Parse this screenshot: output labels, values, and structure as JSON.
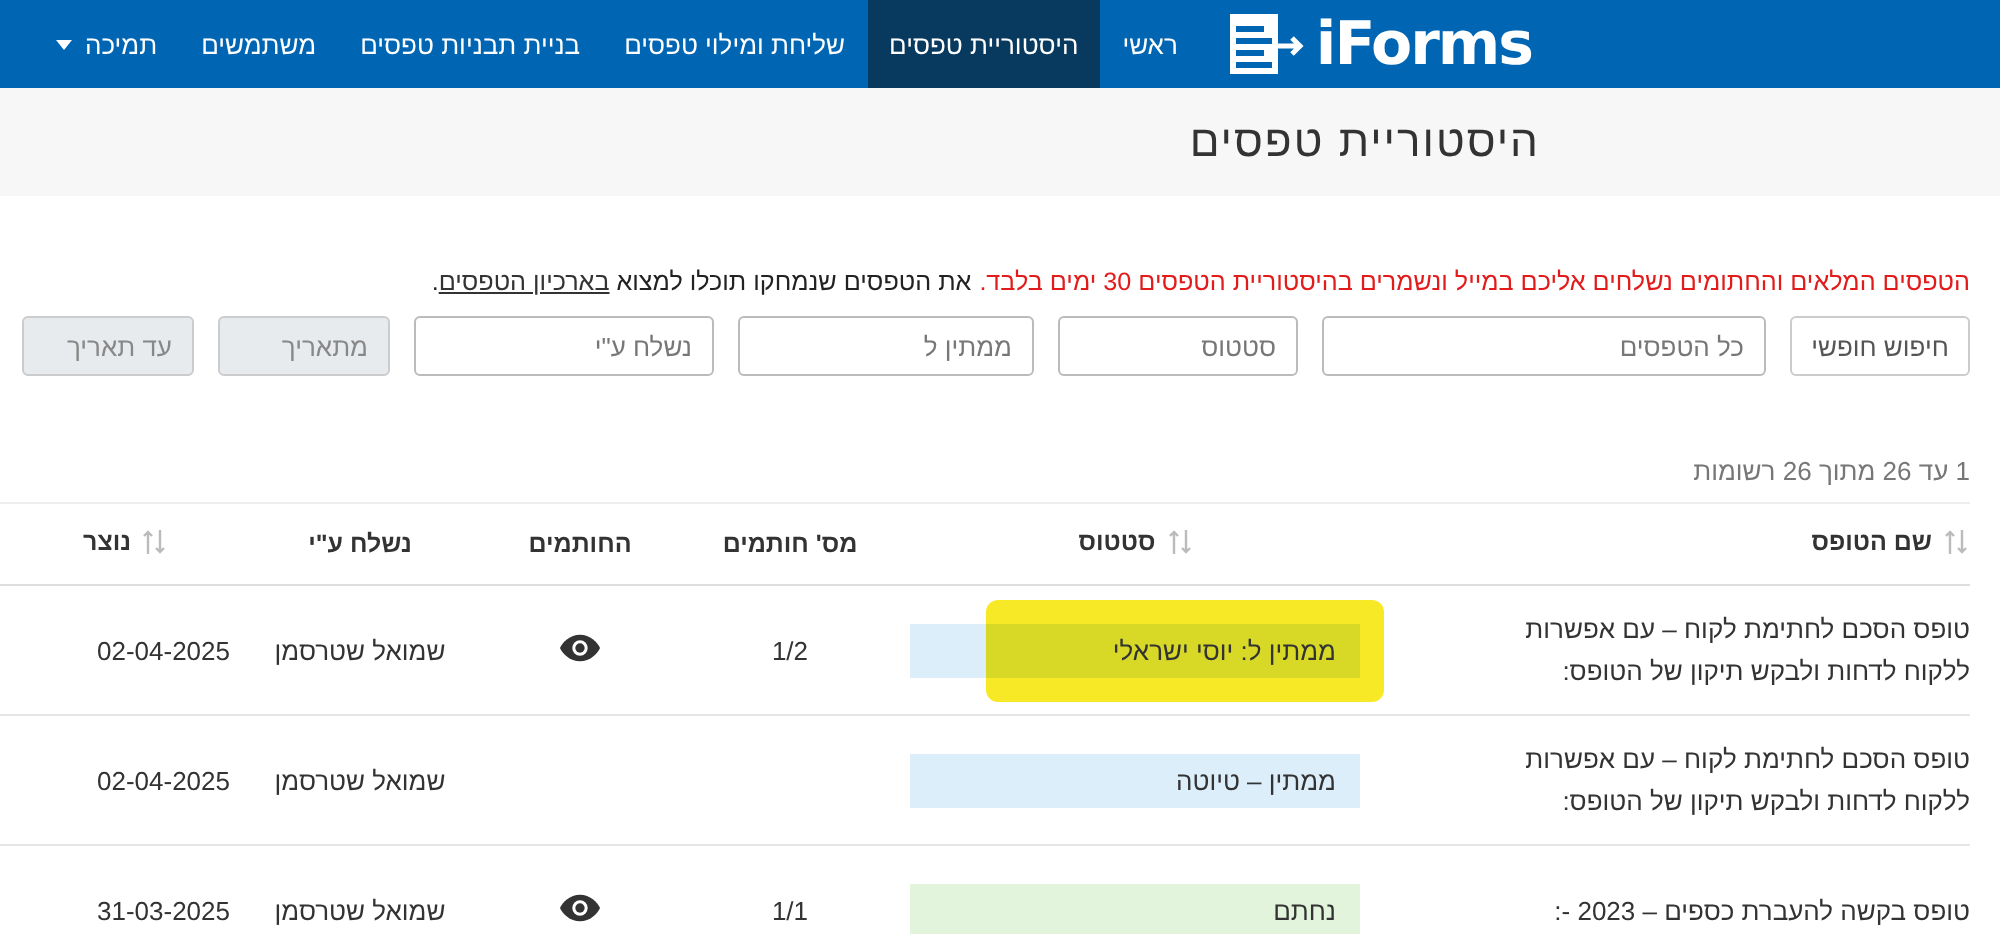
{
  "navbar": {
    "logo": "iForms",
    "items": [
      {
        "label": "ראשי",
        "selected": false,
        "dropdown": false
      },
      {
        "label": "היסטוריית טפסים",
        "selected": true,
        "dropdown": false
      },
      {
        "label": "שליחת ומילוי טפסים",
        "selected": false,
        "dropdown": false
      },
      {
        "label": "בניית תבניות טפסים",
        "selected": false,
        "dropdown": false
      },
      {
        "label": "משתמשים",
        "selected": false,
        "dropdown": false
      },
      {
        "label": "תמיכה",
        "selected": false,
        "dropdown": true
      }
    ]
  },
  "page_title": "היסטוריית טפסים",
  "notice": {
    "warning": "הטפסים המלאים והחתומים נשלחים אליכם במייל ונשמרים בהיסטוריית הטפסים 30 ימים בלבד.",
    "text": "את הטפסים שנמחקו תוכלו למצוא",
    "link": "בארכיון הטפסים",
    "end": "."
  },
  "filters": [
    {
      "kind": "button",
      "label": "חיפוש חופשי"
    },
    {
      "kind": "field",
      "placeholder": "כל הטפסים",
      "disabled": false
    },
    {
      "kind": "field",
      "placeholder": "סטטוס",
      "disabled": false
    },
    {
      "kind": "field",
      "placeholder": "ממתין ל",
      "disabled": false
    },
    {
      "kind": "field",
      "placeholder": "נשלח ע\"י",
      "disabled": false
    },
    {
      "kind": "field",
      "placeholder": "מתאריך",
      "disabled": true
    },
    {
      "kind": "field",
      "placeholder": "עד תאריך",
      "disabled": true
    }
  ],
  "record_count": "1 עד 26 מתוך 26 רשומות",
  "table": {
    "columns": [
      {
        "label": "שם הטופס",
        "sortable": true
      },
      {
        "label": "סטטוס",
        "sortable": true
      },
      {
        "label": "מס' חותמים",
        "sortable": false
      },
      {
        "label": "החותמים",
        "sortable": false
      },
      {
        "label": "נשלח ע\"י",
        "sortable": false
      },
      {
        "label": "נוצר",
        "sortable": true
      }
    ],
    "rows": [
      {
        "name": "טופס הסכם לחתימת לקוח – עם אפשרות ללקוח לדחות ולבקש תיקון של הטופס:",
        "status": {
          "label": "ממתין ל: יוסי ישראלי",
          "color": "#ddeefb"
        },
        "highlighted": true,
        "signers_count": "1/2",
        "has_signers_view": true,
        "sent_by": "שמואל שטרסמן",
        "created": "02-04-2025"
      },
      {
        "name": "טופס הסכם לחתימת לקוח – עם אפשרות ללקוח לדחות ולבקש תיקון של הטופס:",
        "status": {
          "label": "ממתין – טיוטה",
          "color": "#ddeefb"
        },
        "highlighted": false,
        "has_signers_view": false,
        "sent_by": "שמואל שטרסמן",
        "created": "02-04-2025"
      },
      {
        "name": "טופס בקשה להעברת כספים – 2023 -:",
        "status": {
          "label": "נחתם",
          "color": "#e2f5dc"
        },
        "highlighted": false,
        "signers_count": "1/1",
        "has_signers_view": true,
        "sent_by": "שמואל שטרסמן",
        "created": "31-03-2025"
      }
    ]
  }
}
